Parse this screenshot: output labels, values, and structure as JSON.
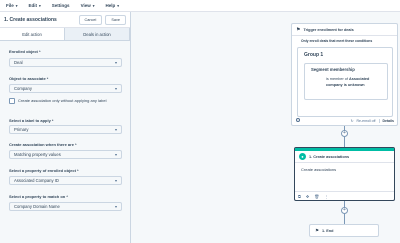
{
  "menubar": {
    "items": [
      {
        "label": "File",
        "caret": "▾"
      },
      {
        "label": "Edit",
        "caret": "▾"
      },
      {
        "label": "Settings",
        "caret": ""
      },
      {
        "label": "View",
        "caret": "▾"
      },
      {
        "label": "Help",
        "caret": "▾"
      }
    ]
  },
  "panel": {
    "title": "1. Create associations",
    "cancel_label": "Cancel",
    "save_label": "Save",
    "tabs": [
      {
        "label": "Edit action",
        "active": true
      },
      {
        "label": "Deals in action",
        "active": false
      }
    ],
    "fields": {
      "enrolled_object": {
        "label": "Enrolled object *",
        "value": "Deal"
      },
      "object_to_associate": {
        "label": "Object to associate *",
        "value": "Company"
      },
      "checkbox_label": "Create association only without applying any label",
      "label_to_apply": {
        "label": "Select a label to apply *",
        "value": "Primary"
      },
      "when_there_are": {
        "label": "Create association when there are *",
        "value": "Matching property values"
      },
      "property_enrolled": {
        "label": "Select a property of enrolled object *",
        "value": "Associated Company ID"
      },
      "property_match": {
        "label": "Select a property to match on *",
        "value": "Company Domain Name"
      }
    }
  },
  "workflow": {
    "trigger": {
      "title": "Trigger enrollment for deals",
      "subtitle": "Only enroll deals that meet these conditions",
      "group_title": "Group 1",
      "segment_title": "Segment membership",
      "segment_line1": "is member of",
      "segment_bold1": "Associated",
      "segment_bold2": "company is unknown",
      "reenroll": "Re-enroll off",
      "details": "Details"
    },
    "action": {
      "title": "1. Create associations",
      "body": "Create associations"
    },
    "end": {
      "title": "1. End"
    },
    "plus_symbol": "+"
  },
  "colors": {
    "accent": "#00bda5",
    "text": "#33475b",
    "border": "#cbd6e2"
  }
}
